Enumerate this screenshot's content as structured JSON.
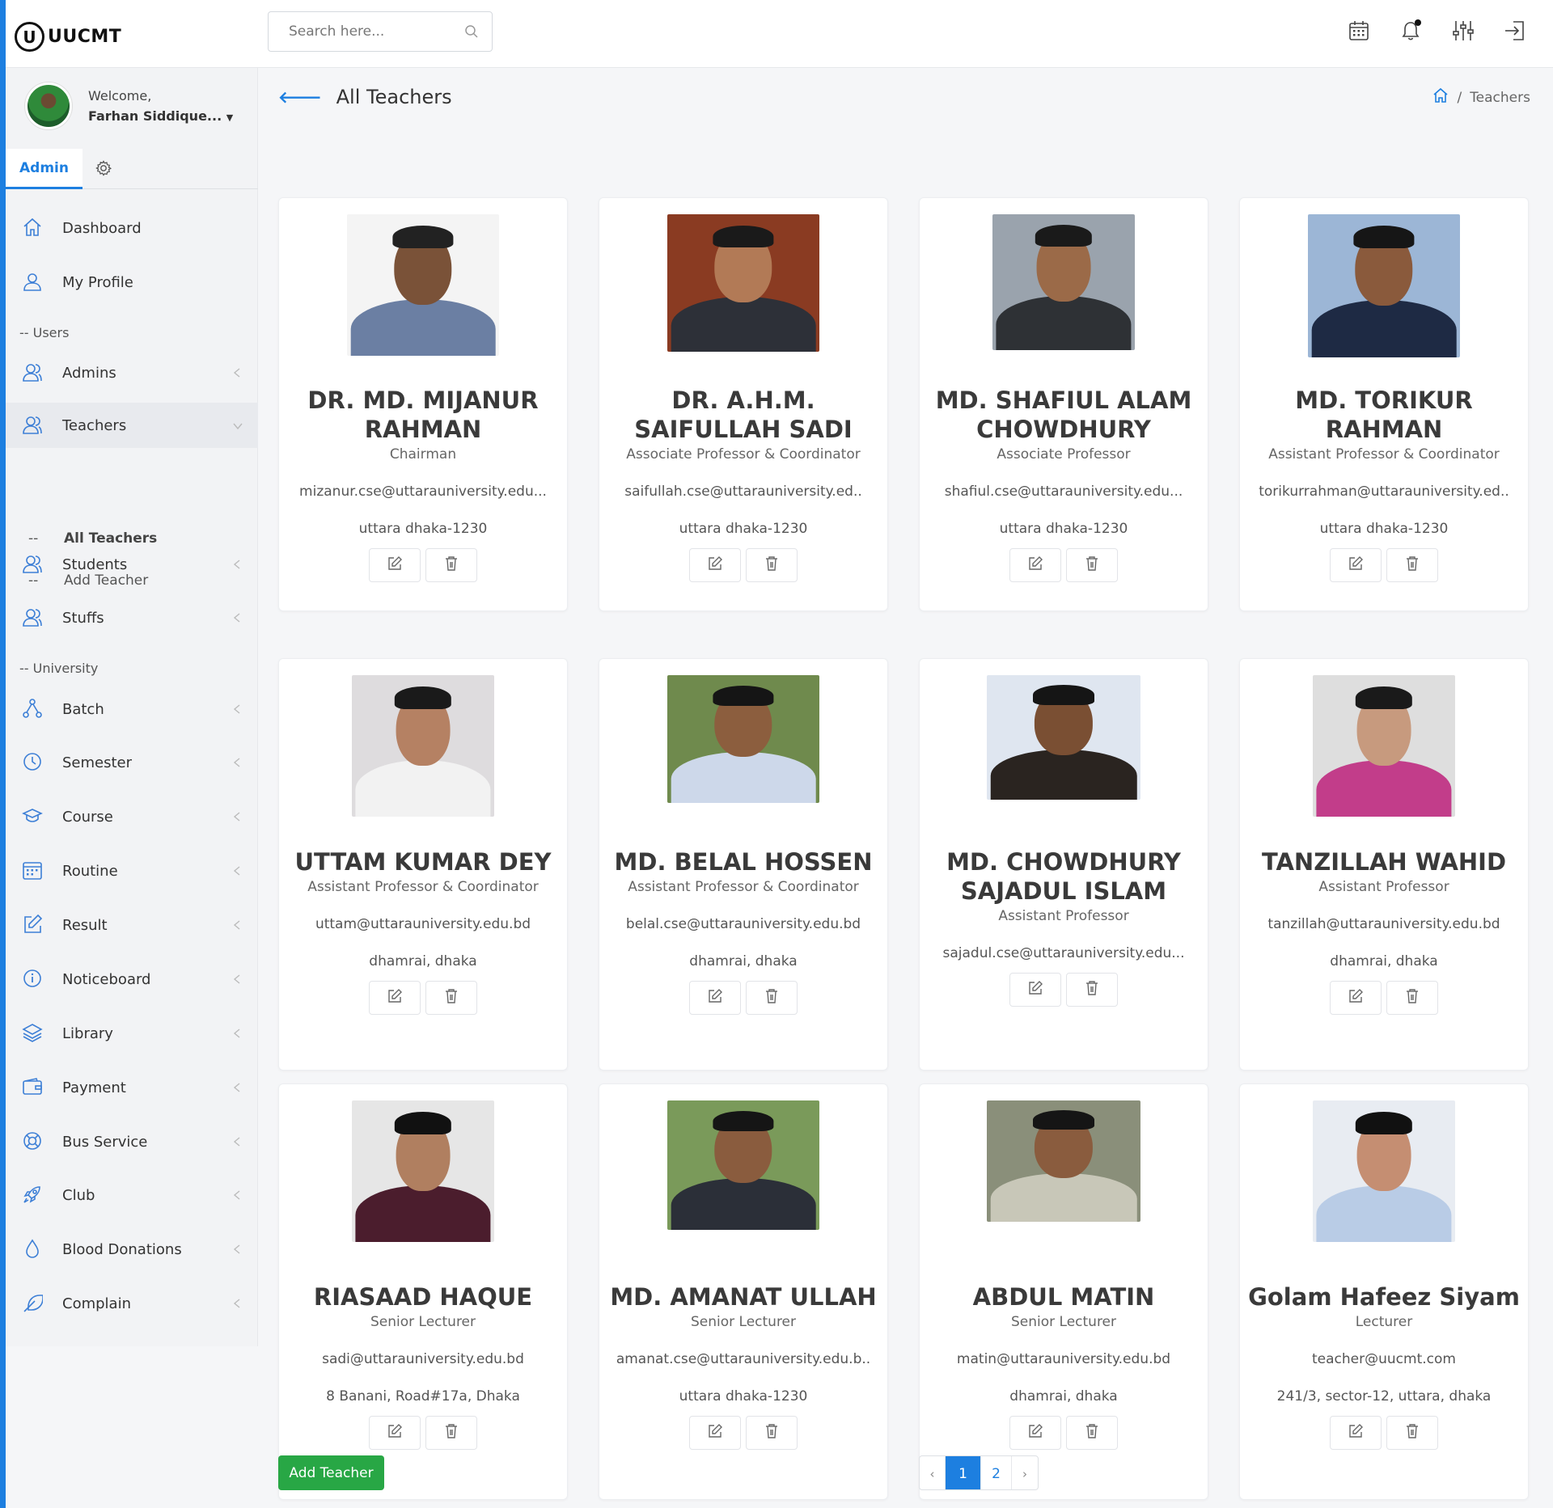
{
  "app": {
    "logo_letter": "U",
    "name": "UUCMT"
  },
  "search": {
    "placeholder": "Search here..."
  },
  "topbar_icons": [
    "calendar-icon",
    "bell-icon",
    "sliders-icon",
    "logout-icon"
  ],
  "sidebar": {
    "welcome": "Welcome,",
    "user_name": "Farhan Siddique...",
    "tab_admin": "Admin",
    "dashboard": "Dashboard",
    "my_profile": "My Profile",
    "section_users": "-- Users",
    "admins": "Admins",
    "teachers": "Teachers",
    "all_teachers": "All Teachers",
    "add_teacher": "Add Teacher",
    "students": "Students",
    "stuffs": "Stuffs",
    "section_university": "-- University",
    "batch": "Batch",
    "semester": "Semester",
    "course": "Course",
    "routine": "Routine",
    "result": "Result",
    "noticeboard": "Noticeboard",
    "library": "Library",
    "payment": "Payment",
    "bus_service": "Bus Service",
    "club": "Club",
    "blood_donations": "Blood Donations",
    "complain": "Complain",
    "sub_dash": "--"
  },
  "page": {
    "title": "All Teachers",
    "breadcrumb_current": "Teachers",
    "breadcrumb_sep": "/"
  },
  "teachers": [
    {
      "name": "DR. MD. MIJANUR RAHMAN",
      "designation": "Chairman",
      "email": "mizanur.cse@uttarauniversity.edu...",
      "address": "uttara dhaka-1230"
    },
    {
      "name": "DR. A.H.M. SAIFULLAH SADI",
      "designation": "Associate Professor & Coordinator",
      "email": "saifullah.cse@uttarauniversity.ed..",
      "address": "uttara dhaka-1230"
    },
    {
      "name": "MD. SHAFIUL ALAM CHOWDHURY",
      "designation": "Associate Professor",
      "email": "shafiul.cse@uttarauniversity.edu...",
      "address": "uttara dhaka-1230"
    },
    {
      "name": "MD. TORIKUR RAHMAN",
      "designation": "Assistant Professor & Coordinator",
      "email": "torikurrahman@uttarauniversity.ed..",
      "address": "uttara dhaka-1230"
    },
    {
      "name": "UTTAM KUMAR DEY",
      "designation": "Assistant Professor & Coordinator",
      "email": "uttam@uttarauniversity.edu.bd",
      "address": "dhamrai, dhaka"
    },
    {
      "name": "MD. BELAL HOSSEN",
      "designation": "Assistant Professor & Coordinator",
      "email": "belal.cse@uttarauniversity.edu.bd",
      "address": "dhamrai, dhaka"
    },
    {
      "name": "MD. CHOWDHURY SAJADUL ISLAM",
      "designation": "Assistant Professor",
      "email": "sajadul.cse@uttarauniversity.edu...",
      "address": ""
    },
    {
      "name": "TANZILLAH WAHID",
      "designation": "Assistant Professor",
      "email": "tanzillah@uttarauniversity.edu.bd",
      "address": "dhamrai, dhaka"
    },
    {
      "name": "RIASAAD HAQUE",
      "designation": "Senior Lecturer",
      "email": "sadi@uttarauniversity.edu.bd",
      "address": "8 Banani, Road#17a, Dhaka"
    },
    {
      "name": "MD. AMANAT ULLAH",
      "designation": "Senior Lecturer",
      "email": "amanat.cse@uttarauniversity.edu.b..",
      "address": "uttara dhaka-1230"
    },
    {
      "name": "ABDUL MATIN",
      "designation": "Senior Lecturer",
      "email": "matin@uttarauniversity.edu.bd",
      "address": "dhamrai, dhaka"
    },
    {
      "name": "Golam Hafeez Siyam",
      "designation": "Lecturer",
      "email": "teacher@uucmt.com",
      "address": "241/3, sector-12, uttara, dhaka"
    }
  ],
  "footer": {
    "add_button": "Add Teacher"
  },
  "pagination": {
    "prev": "‹",
    "page1": "1",
    "page2": "2",
    "next": "›"
  },
  "colors": {
    "accent": "#1d7fe0",
    "success": "#28a745",
    "sidebar_bg": "#f2f3f5"
  }
}
